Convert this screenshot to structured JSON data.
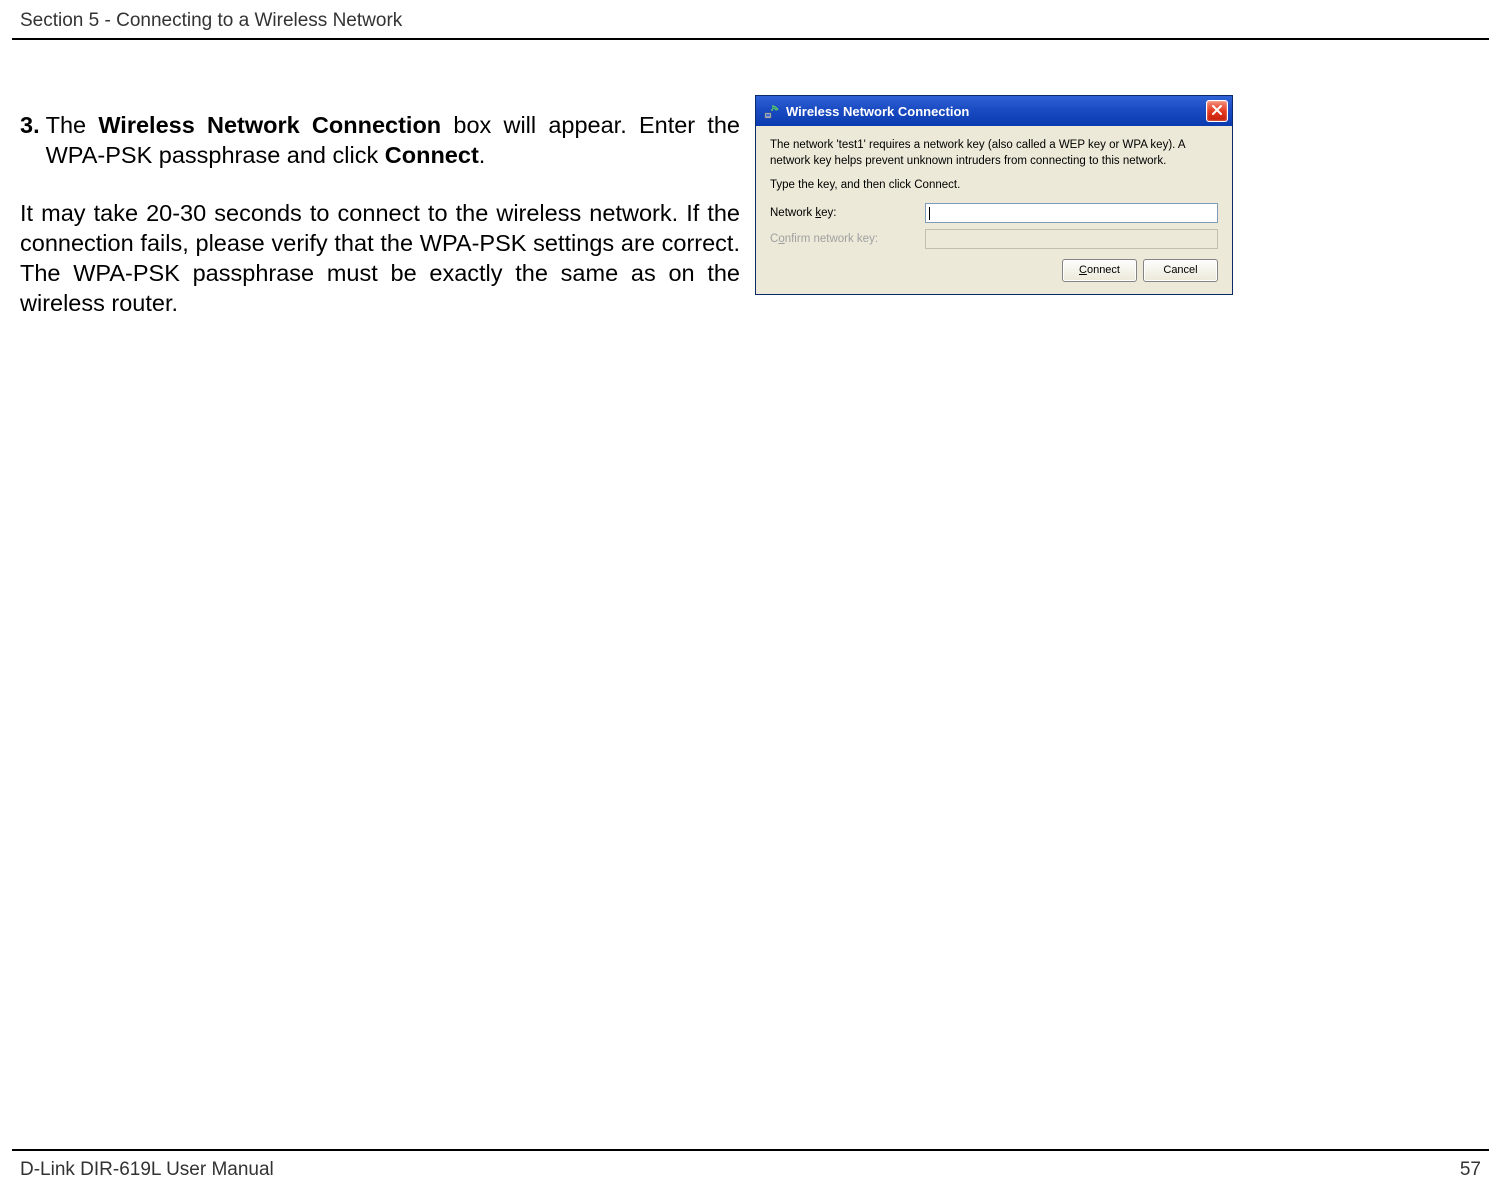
{
  "header": {
    "section_title": "Section 5 - Connecting to a Wireless Network"
  },
  "content": {
    "step_number": "3.",
    "step_text_pre": "The ",
    "step_bold1": "Wireless Network Connection",
    "step_text_mid": " box will appear. Enter the WPA-PSK passphrase and click ",
    "step_bold2": "Connect",
    "step_text_post": ".",
    "paragraph2": "It may take 20-30 seconds to connect to the wireless network. If the connection fails, please verify that the WPA-PSK settings are correct. The WPA-PSK passphrase must be exactly the same as on the wireless router."
  },
  "dialog": {
    "title": "Wireless Network Connection",
    "message1": "The network 'test1' requires a network key (also called a WEP key or WPA key). A network key helps prevent unknown intruders from connecting to this network.",
    "message2": "Type the key, and then click Connect.",
    "label_network_key_pre": "Network ",
    "label_network_key_u": "k",
    "label_network_key_post": "ey:",
    "label_confirm_pre": "C",
    "label_confirm_u": "o",
    "label_confirm_post": "nfirm network key:",
    "button_connect": "Connect",
    "button_cancel": "Cancel",
    "input_network_key": "",
    "input_confirm_key": ""
  },
  "footer": {
    "manual_name": "D-Link DIR-619L User Manual",
    "page_number": "57"
  }
}
